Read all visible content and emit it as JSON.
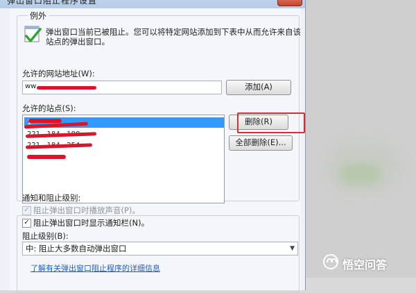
{
  "window": {
    "title": "弹出窗口阻止程序设置",
    "close_glyph": "✕"
  },
  "exceptions": {
    "group_title": "例外",
    "info_text": "弹出窗口当前已被阻止。您可以将特定网站添加到下表中从而允许来自该站点的弹出窗口。",
    "allow_label": "允许的网站地址(W):",
    "allow_input_value": "ww",
    "add_button": "添加(A)",
    "sites_label": "允许的站点(S):",
    "sites": [
      "1",
      "221.  .184.  .188",
      "221.  .184.  .254",
      ""
    ],
    "remove_button": "删除(R)",
    "remove_all_button": "全部删除(E)..."
  },
  "notify": {
    "group_title": "通知和阻止级别:",
    "sound_label": "阻止弹出窗口时播放声音(P)。",
    "sound_checked": true,
    "infobar_label": "阻止弹出窗口时显示通知栏(N)。",
    "infobar_checked": true,
    "level_label": "阻止级别(B):",
    "level_value": "中: 阻止大多数自动弹出窗口",
    "learn_more_link": "了解有关弹出窗口阻止程序的详细信息"
  },
  "watermark": {
    "text": "悟空问答"
  },
  "icons": {
    "info_icon": "popup-checkmark-icon",
    "dropdown_icon": "chevron-down-icon",
    "check": "✓"
  }
}
